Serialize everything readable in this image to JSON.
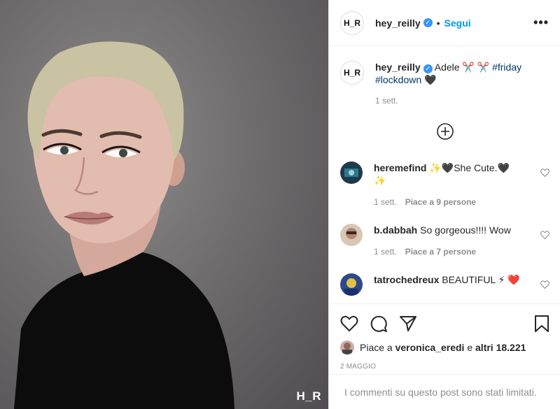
{
  "photo": {
    "watermark": "H_R"
  },
  "header": {
    "avatar_text": "H_R",
    "username": "hey_reilly",
    "dot": "•",
    "follow": "Segui",
    "more": "•••"
  },
  "caption": {
    "avatar_text": "H_R",
    "username": "hey_reilly",
    "text": "Adele ✂️ ✂️",
    "hashtags": [
      "#friday",
      "#lockdown"
    ],
    "emoji": "🖤",
    "time": "1 sett."
  },
  "comments": [
    {
      "username": "heremefind",
      "text": "✨🖤She Cute.🖤 ✨",
      "time": "1 sett.",
      "likes": "Piace a 9 persone"
    },
    {
      "username": "b.dabbah",
      "text": "So gorgeous!!!! Wow",
      "time": "1 sett.",
      "likes": "Piace a 7 persone"
    },
    {
      "username": "tatrochedreux",
      "text": "BEAUTIFUL ⚡ ❤️",
      "time": "",
      "likes": ""
    }
  ],
  "likes_line": {
    "prefix": "Piace a ",
    "user": "veronica_eredi",
    "middle": " e ",
    "others": "altri 18.221"
  },
  "date": "2 maggio",
  "limited": "I commenti su questo post sono stati limitati.",
  "colors": {
    "link": "#0095f6",
    "hashtag": "#00376b",
    "muted": "#8e8e8e",
    "verified": "#3897f0"
  },
  "icons": [
    "heart-icon",
    "comment-icon",
    "share-icon",
    "bookmark-icon",
    "plus-circle-icon",
    "more-icon"
  ]
}
